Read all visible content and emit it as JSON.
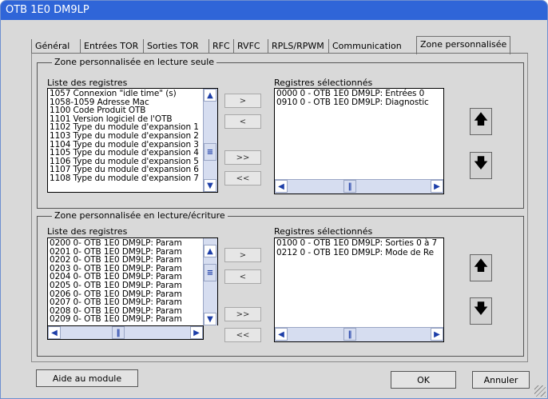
{
  "window": {
    "title": "OTB 1E0 DM9LP"
  },
  "tabs": [
    {
      "label": "Général"
    },
    {
      "label": "Entrées TOR"
    },
    {
      "label": "Sorties TOR"
    },
    {
      "label": "RFC"
    },
    {
      "label": "RVFC"
    },
    {
      "label": "RPLS/RPWM"
    },
    {
      "label": "Communication"
    },
    {
      "label": "Zone personnalisée"
    }
  ],
  "readonly_group": {
    "title": "Zone personnalisée en lecture seule",
    "list_label": "Liste des registres",
    "selected_label": "Registres sélectionnés",
    "registers": [
      "1057 Connexion \"idle time\" (s)",
      "1058-1059 Adresse Mac",
      "1100 Code Produit OTB",
      "1101 Version logiciel de l'OTB",
      "1102 Type du module d'expansion 1",
      "1103 Type du module d'expansion 2",
      "1104 Type du module d'expansion 3",
      "1105 Type du module d'expansion 4",
      "1106 Type du module d'expansion 5",
      "1107 Type du module d'expansion 6",
      "1108 Type du module d'expansion 7"
    ],
    "selected": [
      "0000 0 - OTB 1E0 DM9LP: Entrées 0",
      "0910 0 - OTB 1E0 DM9LP: Diagnostic"
    ]
  },
  "readwrite_group": {
    "title": "Zone personnalisée en lecture/écriture",
    "list_label": "Liste des registres",
    "selected_label": "Registres sélectionnés",
    "registers": [
      "0200 0- OTB 1E0 DM9LP: Param",
      "0201 0- OTB 1E0 DM9LP: Param",
      "0202 0- OTB 1E0 DM9LP: Param",
      "0203 0- OTB 1E0 DM9LP: Param",
      "0204 0- OTB 1E0 DM9LP: Param",
      "0205 0- OTB 1E0 DM9LP: Param",
      "0206 0- OTB 1E0 DM9LP: Param",
      "0207 0- OTB 1E0 DM9LP: Param",
      "0208 0- OTB 1E0 DM9LP: Param",
      "0209 0- OTB 1E0 DM9LP: Param"
    ],
    "selected": [
      "0100 0 - OTB 1E0 DM9LP: Sorties 0 à 7",
      "0212 0 - OTB 1E0 DM9LP: Mode de Re"
    ]
  },
  "transfer_buttons": {
    "add": ">",
    "remove": "<",
    "add_all": ">>",
    "remove_all": "<<"
  },
  "footer": {
    "help": "Aide au module",
    "ok": "OK",
    "cancel": "Annuler"
  }
}
